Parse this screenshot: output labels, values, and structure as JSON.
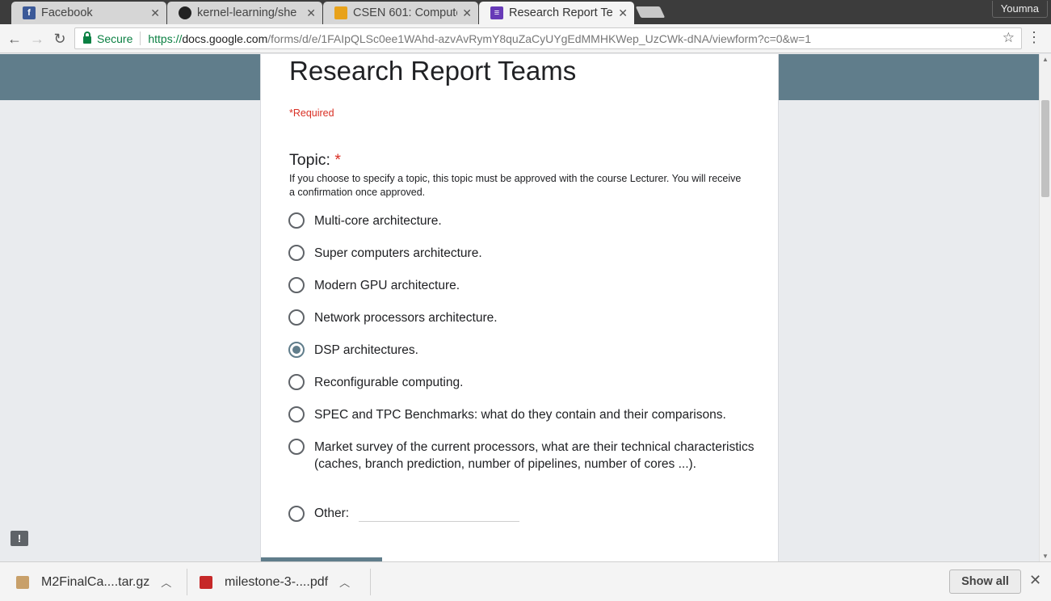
{
  "browser": {
    "tabs": [
      {
        "label": "Facebook",
        "icon": "facebook-icon",
        "color": "#3b5998"
      },
      {
        "label": "kernel-learning/she",
        "icon": "github-icon",
        "color": "#222222"
      },
      {
        "label": "CSEN 601: Compute",
        "icon": "course-site-icon",
        "color": "#e8a21a"
      },
      {
        "label": "Research Report Te",
        "icon": "google-forms-icon",
        "color": "#673ab7",
        "active": true
      }
    ],
    "profile_name": "Youmna",
    "secure_label": "Secure",
    "url_scheme": "https://",
    "url_host": "docs.google.com",
    "url_path": "/forms/d/e/1FAIpQLSc0ee1WAhd-azvAvRymY8quZaCyUYgEdMMHKWep_UzCWk-dNA/viewform?c=0&w=1"
  },
  "form": {
    "title": "Research Report Teams",
    "required_note": "*Required",
    "banner_color": "#607d8b",
    "question": {
      "title": "Topic: ",
      "required_mark": "*",
      "help": "If you choose to specify a topic, this topic must be approved with the course Lecturer. You will receive a confirmation once approved.",
      "options": [
        {
          "label": "Multi-core architecture.",
          "checked": false
        },
        {
          "label": "Super computers architecture.",
          "checked": false
        },
        {
          "label": "Modern GPU architecture.",
          "checked": false
        },
        {
          "label": "Network processors architecture.",
          "checked": false
        },
        {
          "label": "DSP architectures.",
          "checked": true
        },
        {
          "label": "Reconfigurable computing.",
          "checked": false
        },
        {
          "label": "SPEC and TPC Benchmarks: what do they contain and their comparisons.",
          "checked": false
        },
        {
          "label": "Market survey of the current processors, what are their technical characteristics (caches, branch prediction, number of pipelines, number of cores ...).",
          "checked": false
        }
      ],
      "other_label": "Other:",
      "other_value": ""
    }
  },
  "downloads": {
    "items": [
      {
        "filename": "M2FinalCa....tar.gz",
        "icon": "archive-icon"
      },
      {
        "filename": "milestone-3-....pdf",
        "icon": "pdf-icon"
      }
    ],
    "show_all_label": "Show all"
  }
}
